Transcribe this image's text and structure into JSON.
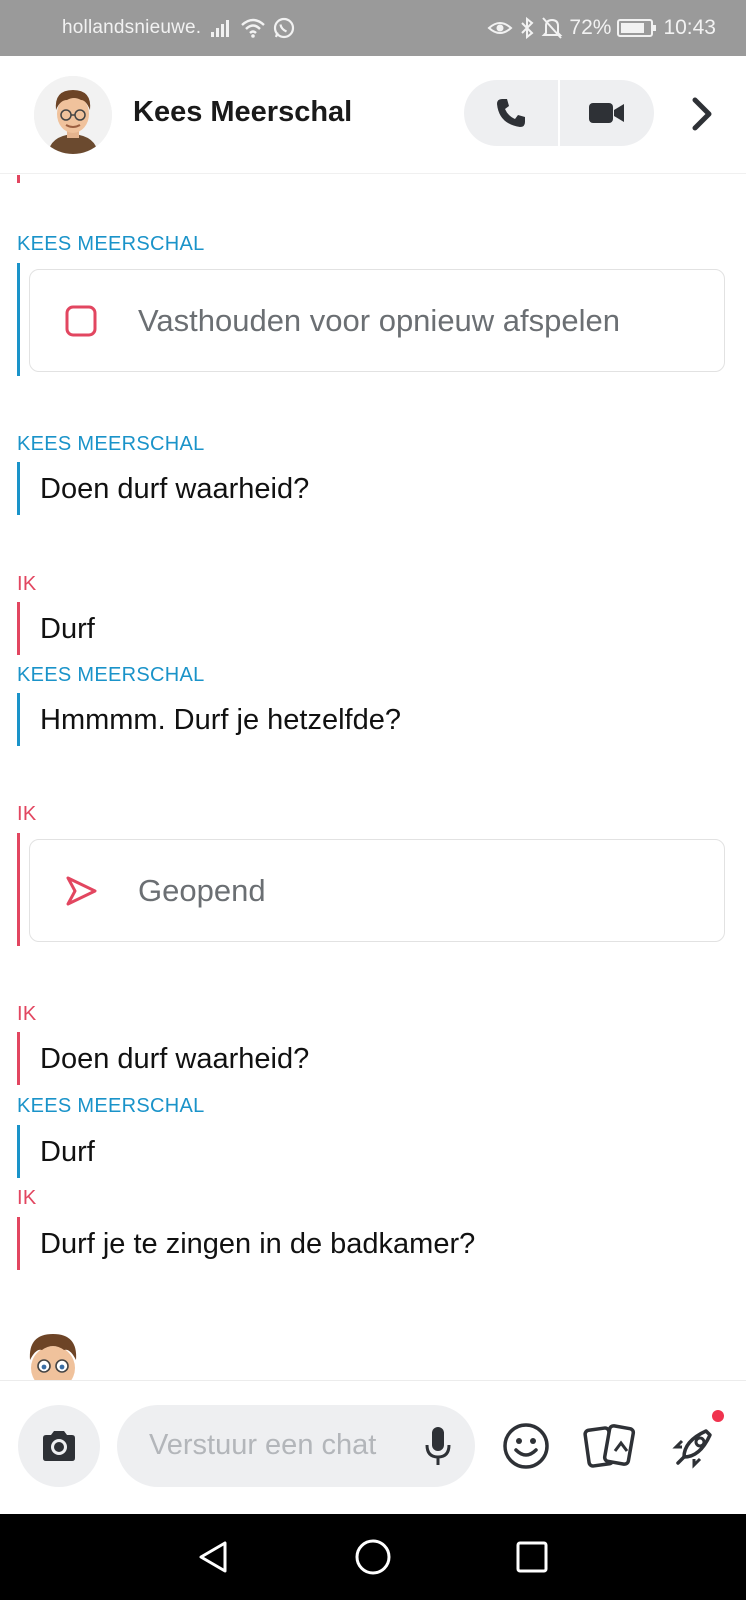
{
  "status_bar": {
    "carrier": "hollandsnieuwe.",
    "battery": "72%",
    "time": "10:43"
  },
  "header": {
    "contact_name": "Kees Meerschal"
  },
  "messages": [
    {
      "sender": "KEES MEERSCHAL",
      "kind": "snap",
      "text": "Vasthouden voor opnieuw afspelen"
    },
    {
      "sender": "KEES MEERSCHAL",
      "kind": "text",
      "text": "Doen durf waarheid?"
    },
    {
      "sender": "IK",
      "kind": "text",
      "text": "Durf"
    },
    {
      "sender": "KEES MEERSCHAL",
      "kind": "text",
      "text": "Hmmmm. Durf je hetzelfde?"
    },
    {
      "sender": "IK",
      "kind": "snap",
      "text": "Geopend"
    },
    {
      "sender": "IK",
      "kind": "text",
      "text": "Doen durf waarheid?"
    },
    {
      "sender": "KEES MEERSCHAL",
      "kind": "text",
      "text": "Durf"
    },
    {
      "sender": "IK",
      "kind": "text",
      "text": "Durf je te zingen in de badkamer?"
    }
  ],
  "input_bar": {
    "placeholder": "Verstuur een chat"
  },
  "colors": {
    "contact_accent": "#1a93c9",
    "me_accent": "#e24660",
    "status_bar_bg": "#9a9a9a",
    "notification_dot": "#f0334e"
  },
  "icons": [
    "camera-icon",
    "microphone-icon",
    "emoji-icon",
    "stickers-icon",
    "rocket-icon",
    "phone-icon",
    "video-icon",
    "chevron-right-icon",
    "stop-square-icon",
    "sent-arrow-icon",
    "back-icon",
    "home-icon",
    "recents-icon"
  ]
}
